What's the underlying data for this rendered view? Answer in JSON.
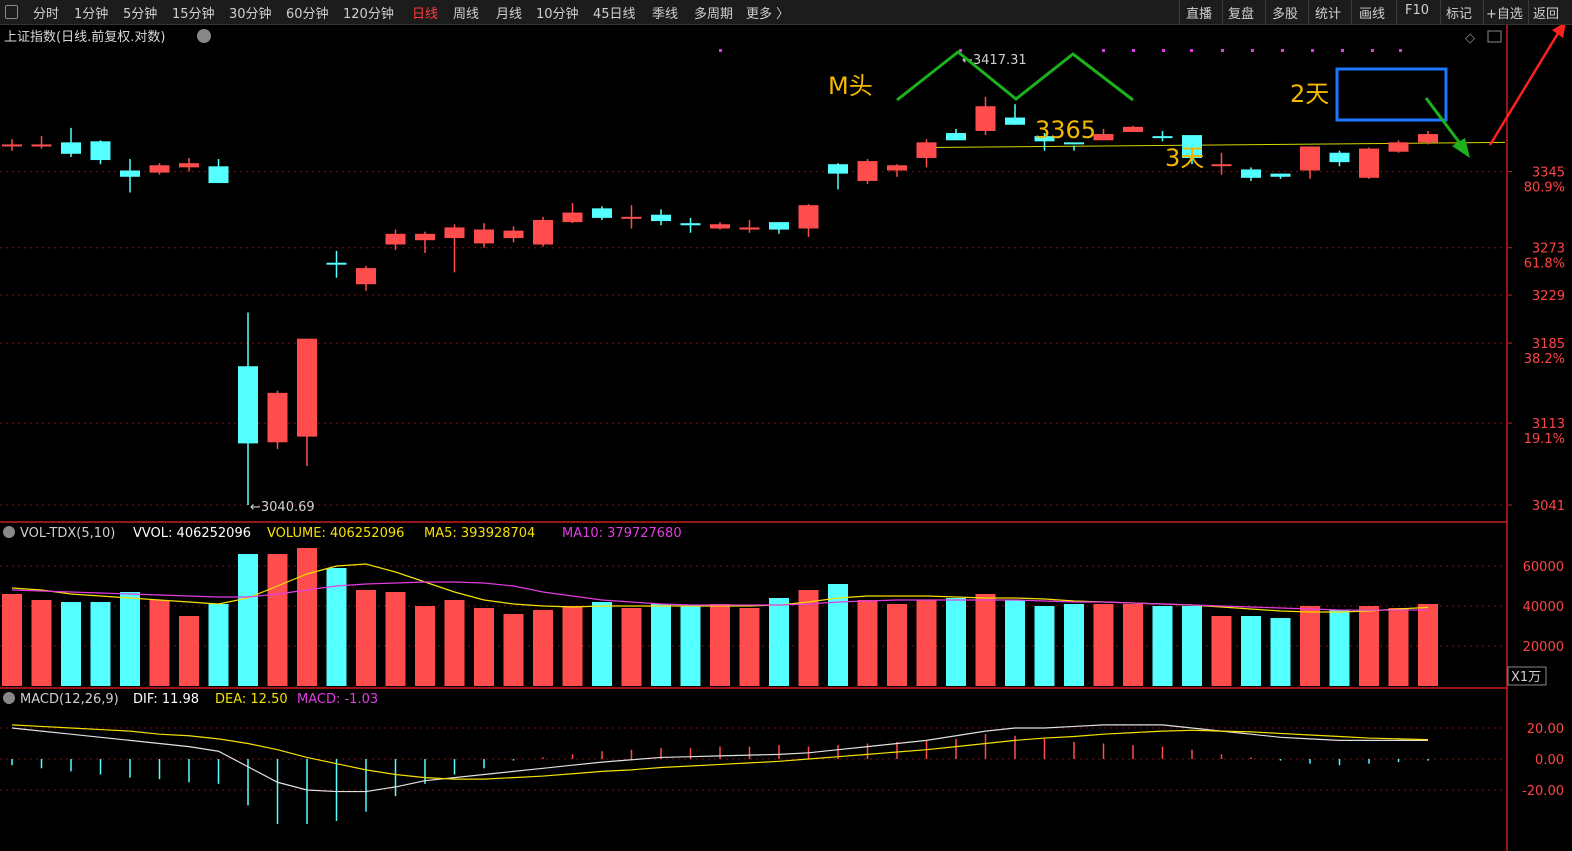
{
  "toolbar": {
    "left": [
      "分时",
      "1分钟",
      "5分钟",
      "15分钟",
      "30分钟",
      "60分钟",
      "120分钟",
      "日线",
      "周线",
      "月线",
      "10分钟",
      "45日线",
      "季线",
      "多周期",
      "更多 〉"
    ],
    "active": "日线",
    "right": [
      "直播",
      "复盘",
      "多股",
      "统计",
      "画线",
      "F10",
      "标记",
      "+自选",
      "返回"
    ]
  },
  "main_title": "上证指数(日线.前复权.对数)",
  "vol_header": [
    {
      "text": "VOL-TDX(5,10)",
      "color": "#d0d0d0"
    },
    {
      "text": "VVOL: 406252096",
      "color": "#ffffff"
    },
    {
      "text": "VOLUME: 406252096",
      "color": "#f5e000"
    },
    {
      "text": "MA5: 393928704",
      "color": "#f5e000"
    },
    {
      "text": "MA10: 379727680",
      "color": "#e23de2"
    }
  ],
  "macd_header": [
    {
      "text": "MACD(12,26,9)",
      "color": "#d0d0d0"
    },
    {
      "text": "DIF: 11.98",
      "color": "#ffffff"
    },
    {
      "text": "DEA: 12.50",
      "color": "#f5e000"
    },
    {
      "text": "MACD: -1.03",
      "color": "#e23de2"
    }
  ],
  "vol_unit": "X1万",
  "colors": {
    "up": "#ff4d4d",
    "down": "#54ffff",
    "axis": "#c81e1e",
    "annot": "#f5b800",
    "green": "#1bb21b",
    "blue": "#1e78ff",
    "ma5": "#f5e000",
    "ma10": "#e23de2",
    "dif": "#e0e0e0",
    "dea": "#f5e000"
  },
  "chart_data": [
    {
      "type": "candlestick",
      "title": "上证指数(日线.前复权.对数)",
      "y_scale": "log",
      "ylim": [
        3035,
        3425
      ],
      "y_ticks": [
        {
          "value": 3345,
          "label": "3345",
          "pct": "80.9%"
        },
        {
          "value": 3273,
          "label": "3273",
          "pct": "61.8%"
        },
        {
          "value": 3229,
          "label": "3229",
          "pct": null
        },
        {
          "value": 3185,
          "label": "3185",
          "pct": "38.2%"
        },
        {
          "value": 3113,
          "label": "3113",
          "pct": "19.1%"
        },
        {
          "value": 3041,
          "label": "3041",
          "pct": null
        }
      ],
      "candles": [
        [
          3371,
          3371,
          3376,
          3365
        ],
        [
          3369,
          3371,
          3379,
          3367
        ],
        [
          3373,
          3362,
          3387,
          3359
        ],
        [
          3374,
          3356,
          3375,
          3352
        ],
        [
          3346,
          3340,
          3357,
          3325
        ],
        [
          3344,
          3351,
          3353,
          3342
        ],
        [
          3349,
          3353,
          3358,
          3345
        ],
        [
          3350,
          3334,
          3357,
          3334
        ],
        [
          3164,
          3095,
          3213,
          3041
        ],
        [
          3096,
          3140,
          3142,
          3090
        ],
        [
          3101,
          3189,
          3189,
          3075
        ],
        [
          3259,
          3258,
          3270,
          3245
        ],
        [
          3239,
          3254,
          3256,
          3233
        ],
        [
          3276,
          3286,
          3290,
          3271
        ],
        [
          3280,
          3286,
          3288,
          3268
        ],
        [
          3282,
          3292,
          3295,
          3250
        ],
        [
          3277,
          3290,
          3296,
          3273
        ],
        [
          3282,
          3289,
          3293,
          3278
        ],
        [
          3276,
          3299,
          3302,
          3274
        ],
        [
          3297,
          3306,
          3315,
          3296
        ],
        [
          3310,
          3301,
          3312,
          3299
        ],
        [
          3301,
          3302,
          3313,
          3291
        ],
        [
          3304,
          3298,
          3309,
          3294
        ],
        [
          3296,
          3294,
          3301,
          3287
        ],
        [
          3291,
          3295,
          3297,
          3290
        ],
        [
          3290,
          3292,
          3299,
          3287
        ],
        [
          3297,
          3290,
          3293,
          3286
        ],
        [
          3291,
          3313,
          3314,
          3283
        ],
        [
          3352,
          3343,
          3353,
          3328
        ],
        [
          3336,
          3355,
          3357,
          3333
        ],
        [
          3346,
          3351,
          3352,
          3340
        ],
        [
          3358,
          3373,
          3376,
          3349
        ],
        [
          3382,
          3375,
          3386,
          3376
        ],
        [
          3384,
          3408,
          3417,
          3380
        ],
        [
          3397,
          3390,
          3410,
          3390
        ],
        [
          3379,
          3374,
          3382,
          3365
        ],
        [
          3373,
          3372,
          3370,
          3365
        ],
        [
          3375,
          3381,
          3386,
          3375
        ],
        [
          3383,
          3388,
          3389,
          3383
        ],
        [
          3379,
          3378,
          3384,
          3374
        ],
        [
          3380,
          3358,
          3380,
          3352
        ],
        [
          3351,
          3352,
          3363,
          3342
        ],
        [
          3347,
          3339,
          3349,
          3336
        ],
        [
          3343,
          3340,
          3343,
          3338
        ],
        [
          3346,
          3369,
          3369,
          3338
        ],
        [
          3363,
          3354,
          3365,
          3350
        ],
        [
          3339,
          3367,
          3368,
          3338
        ],
        [
          3364,
          3373,
          3375,
          3363
        ],
        [
          3373,
          3381,
          3384,
          3371
        ]
      ],
      "annotations": [
        {
          "text": "M头"
        },
        {
          "text": "3365"
        },
        {
          "text": "3天"
        },
        {
          "text": "2天"
        },
        {
          "text": "3417.31"
        },
        {
          "text": "3040.69"
        }
      ]
    },
    {
      "type": "bar",
      "title": "VOL-TDX(5,10)",
      "unit": "X1万",
      "ylim": [
        0,
        70000
      ],
      "y_ticks": [
        20000,
        40000,
        60000
      ],
      "volumes": [
        46000,
        43000,
        42000,
        42000,
        47000,
        43000,
        35000,
        41000,
        66000,
        66000,
        69000,
        59000,
        48000,
        47000,
        40000,
        43000,
        39000,
        36000,
        38000,
        40000,
        42000,
        39000,
        41000,
        40000,
        41000,
        39000,
        44000,
        48000,
        51000,
        43000,
        41000,
        43000,
        44000,
        46000,
        43000,
        40000,
        41000,
        41000,
        41000,
        40000,
        40000,
        35000,
        35000,
        34000,
        40000,
        38000,
        40000,
        39000,
        41000
      ],
      "ma5": [
        49000,
        48000,
        46000,
        45000,
        44000,
        43000,
        42000,
        41000,
        44000,
        50000,
        56000,
        60000,
        61000,
        57000,
        52000,
        47000,
        43000,
        41000,
        40000,
        39500,
        40000,
        40000,
        40000,
        40000,
        40000,
        40000,
        40500,
        42000,
        44000,
        45000,
        45000,
        45000,
        44500,
        44000,
        44000,
        43500,
        42500,
        42000,
        41500,
        41000,
        40500,
        39500,
        38500,
        37500,
        37000,
        37000,
        37500,
        38500,
        39300
      ],
      "ma10": [
        48000,
        47500,
        47000,
        46500,
        46000,
        45500,
        45000,
        44500,
        44500,
        46000,
        48000,
        50000,
        51000,
        51500,
        52000,
        52000,
        51500,
        50000,
        47000,
        45000,
        43000,
        42000,
        41000,
        40500,
        40500,
        40500,
        40500,
        41000,
        42000,
        42500,
        43000,
        43000,
        43000,
        43000,
        43000,
        42500,
        42000,
        42000,
        41500,
        41000,
        40500,
        40000,
        39500,
        39000,
        38500,
        38000,
        37900,
        38000,
        37970
      ]
    },
    {
      "type": "line",
      "title": "MACD(12,26,9)",
      "ylim": [
        -28,
        30
      ],
      "y_ticks": [
        20,
        0,
        -20
      ],
      "dif": [
        20,
        18,
        16,
        14,
        12,
        10,
        8,
        5,
        -5,
        -15,
        -20,
        -21,
        -21,
        -18,
        -14,
        -12,
        -10,
        -8,
        -6,
        -4,
        -2,
        -0.5,
        1,
        1.5,
        2,
        2.5,
        3,
        4,
        6,
        8,
        10,
        12,
        15,
        18,
        20,
        20,
        21,
        22,
        22,
        22,
        20,
        18,
        16,
        14,
        13,
        12,
        12,
        12,
        12
      ],
      "dea": [
        22,
        21,
        20,
        19,
        18,
        16,
        15,
        13,
        10,
        6,
        1,
        -3,
        -7,
        -10,
        -12,
        -13,
        -13,
        -12,
        -11,
        -9.5,
        -8,
        -7,
        -5.5,
        -4.5,
        -3.5,
        -2.5,
        -1.5,
        0,
        1.5,
        3,
        4.5,
        6,
        8,
        10,
        12,
        13.5,
        14.5,
        16,
        17,
        18,
        18.5,
        18,
        17.5,
        16.5,
        15.5,
        14.5,
        13.5,
        13,
        12.5
      ],
      "macd": [
        -4,
        -6,
        -8,
        -10,
        -12,
        -13,
        -15,
        -16,
        -30,
        -42,
        -42,
        -40,
        -34,
        -24,
        -16,
        -10,
        -6,
        -1,
        1,
        3,
        5,
        6,
        7,
        7,
        8,
        8,
        9,
        8,
        9,
        10,
        11,
        12,
        13,
        16,
        15,
        13,
        11,
        10,
        9,
        8,
        6,
        3,
        1,
        -1,
        -3,
        -4,
        -3,
        -2,
        -1.03
      ]
    }
  ]
}
